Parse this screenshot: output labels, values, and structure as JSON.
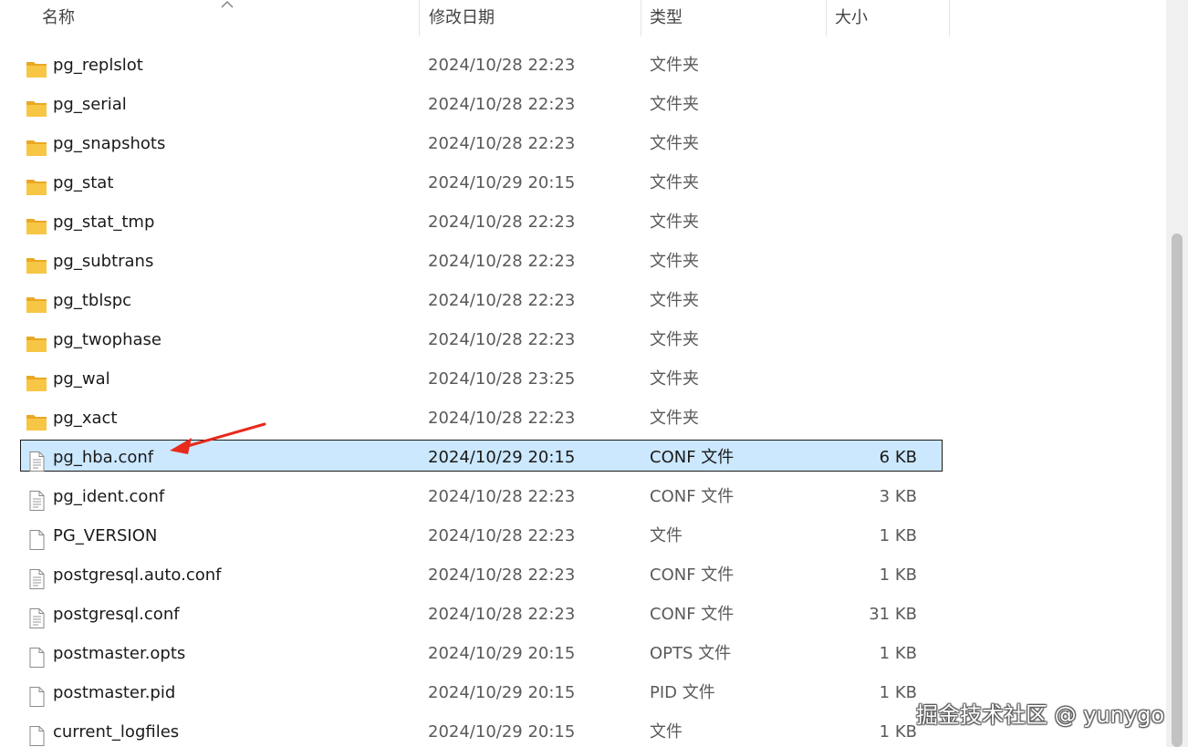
{
  "columns": {
    "name": "名称",
    "date": "修改日期",
    "type": "类型",
    "size": "大小"
  },
  "files": [
    {
      "name": "pg_replslot",
      "date": "2024/10/28 22:23",
      "type": "文件夹",
      "size": "",
      "icon": "folder-icon"
    },
    {
      "name": "pg_serial",
      "date": "2024/10/28 22:23",
      "type": "文件夹",
      "size": "",
      "icon": "folder-icon"
    },
    {
      "name": "pg_snapshots",
      "date": "2024/10/28 22:23",
      "type": "文件夹",
      "size": "",
      "icon": "folder-icon"
    },
    {
      "name": "pg_stat",
      "date": "2024/10/29 20:15",
      "type": "文件夹",
      "size": "",
      "icon": "folder-icon"
    },
    {
      "name": "pg_stat_tmp",
      "date": "2024/10/28 22:23",
      "type": "文件夹",
      "size": "",
      "icon": "folder-icon"
    },
    {
      "name": "pg_subtrans",
      "date": "2024/10/28 22:23",
      "type": "文件夹",
      "size": "",
      "icon": "folder-icon"
    },
    {
      "name": "pg_tblspc",
      "date": "2024/10/28 22:23",
      "type": "文件夹",
      "size": "",
      "icon": "folder-icon"
    },
    {
      "name": "pg_twophase",
      "date": "2024/10/28 22:23",
      "type": "文件夹",
      "size": "",
      "icon": "folder-icon"
    },
    {
      "name": "pg_wal",
      "date": "2024/10/28 23:25",
      "type": "文件夹",
      "size": "",
      "icon": "folder-icon"
    },
    {
      "name": "pg_xact",
      "date": "2024/10/28 22:23",
      "type": "文件夹",
      "size": "",
      "icon": "folder-icon"
    },
    {
      "name": "pg_hba.conf",
      "date": "2024/10/29 20:15",
      "type": "CONF 文件",
      "size": "6 KB",
      "icon": "text-file-icon",
      "selected": true
    },
    {
      "name": "pg_ident.conf",
      "date": "2024/10/28 22:23",
      "type": "CONF 文件",
      "size": "3 KB",
      "icon": "text-file-icon"
    },
    {
      "name": "PG_VERSION",
      "date": "2024/10/28 22:23",
      "type": "文件",
      "size": "1 KB",
      "icon": "blank-file-icon"
    },
    {
      "name": "postgresql.auto.conf",
      "date": "2024/10/28 22:23",
      "type": "CONF 文件",
      "size": "1 KB",
      "icon": "text-file-icon"
    },
    {
      "name": "postgresql.conf",
      "date": "2024/10/28 22:23",
      "type": "CONF 文件",
      "size": "31 KB",
      "icon": "text-file-icon"
    },
    {
      "name": "postmaster.opts",
      "date": "2024/10/29 20:15",
      "type": "OPTS 文件",
      "size": "1 KB",
      "icon": "blank-file-icon"
    },
    {
      "name": "postmaster.pid",
      "date": "2024/10/29 20:15",
      "type": "PID 文件",
      "size": "1 KB",
      "icon": "blank-file-icon"
    },
    {
      "name": "current_logfiles",
      "date": "2024/10/29 20:15",
      "type": "文件",
      "size": "1 KB",
      "icon": "blank-file-icon"
    }
  ],
  "watermark": "掘金技术社区 @ yunygo",
  "colors": {
    "selection": "#cce8ff",
    "folder": "#f8c645",
    "annotation_arrow": "#e8291c"
  }
}
